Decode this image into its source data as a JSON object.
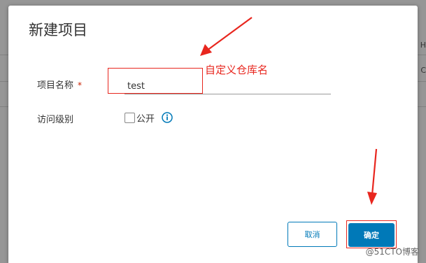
{
  "dialog": {
    "title": "新建项目"
  },
  "form": {
    "project_name_label": "项目名称",
    "required_marker": "*",
    "project_name_value": "test",
    "access_level_label": "访问级别",
    "public_checkbox_label": "公开",
    "public_checked": false
  },
  "annotation": {
    "text": "自定义仓库名",
    "color": "#e8261e"
  },
  "buttons": {
    "cancel_label": "取消",
    "ok_label": "确定"
  },
  "background": {
    "edge_letters": [
      "H",
      "C"
    ]
  },
  "watermark": {
    "text": "@51CTO博客"
  },
  "colors": {
    "accent": "#0079b8",
    "required": "#c92100"
  },
  "icons": {
    "info": "info-icon",
    "arrow": "red-arrow"
  }
}
